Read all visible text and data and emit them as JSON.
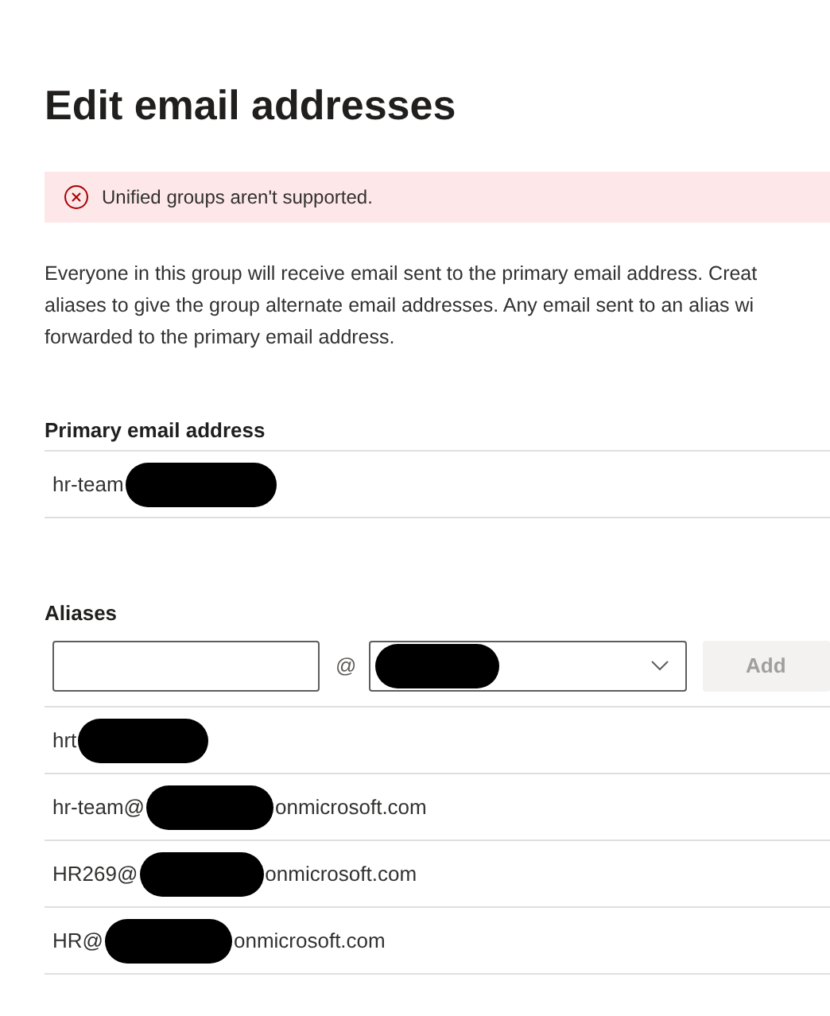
{
  "title": "Edit email addresses",
  "error": {
    "message": "Unified groups aren't supported."
  },
  "description_lines": [
    "Everyone in this group will receive email sent to the primary email address. Creat",
    "aliases to give the group alternate email addresses. Any email sent to an alias wi",
    "forwarded to the primary email address."
  ],
  "primary": {
    "label": "Primary email address",
    "prefix": "hr-team"
  },
  "aliases": {
    "label": "Aliases",
    "at_sign": "@",
    "add_button": {
      "label": "Add",
      "disabled": true
    },
    "rows": [
      {
        "prefix": "hrt"
      },
      {
        "prefix": "hr-team@",
        "suffix": "onmicrosoft.com"
      },
      {
        "prefix": "HR269@",
        "suffix": "onmicrosoft.com"
      },
      {
        "prefix": "HR@",
        "suffix": "onmicrosoft.com"
      }
    ]
  }
}
